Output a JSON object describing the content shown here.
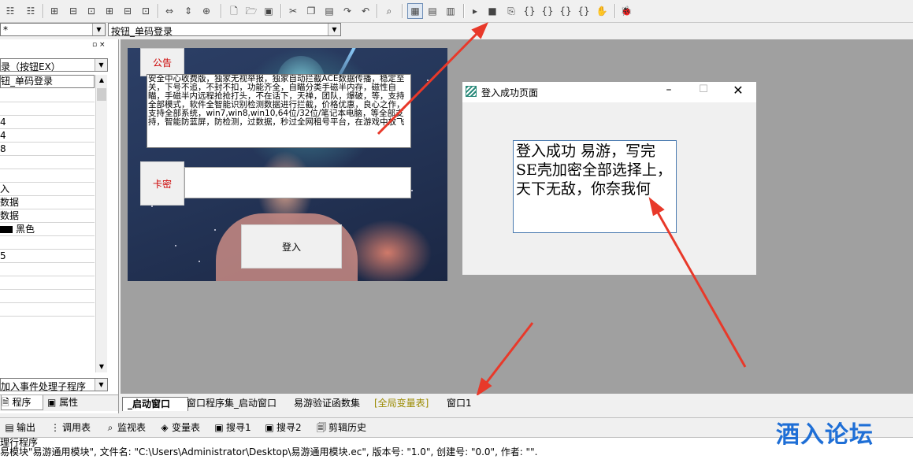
{
  "toolbar": {
    "icons": [
      "align-icon",
      "align-icon",
      "grid-icon",
      "grid-icon",
      "grid-icon",
      "grid-icon",
      "grid-icon",
      "resize-icon",
      "resize-icon",
      "resize-icon",
      "new-file-icon",
      "open-folder-icon",
      "save-icon",
      "cut-icon",
      "copy-icon",
      "paste-icon",
      "undo-icon",
      "redo-icon",
      "find-icon",
      "layout-icon",
      "layout-icon",
      "layout-icon",
      "run-icon",
      "stop-icon",
      "step-icon",
      "step-icon",
      "step-icon",
      "step-icon",
      "step-icon",
      "hand-icon",
      "debug-icon"
    ]
  },
  "combo_left": {
    "value": "*"
  },
  "combo_right": {
    "value": "按钮_单码登录"
  },
  "left_panel": {
    "title_combo": "录（按钮EX）",
    "name_row": "钮_单码登录",
    "rows": [
      "",
      "",
      "4",
      "4",
      "8",
      "",
      "",
      "入",
      "数据",
      "数据",
      "黑色",
      "",
      "5",
      "",
      "",
      "",
      ""
    ],
    "color_label": "黑色",
    "event_combo": "加入事件处理子程序",
    "tab_program": "程序",
    "tab_property": "属性"
  },
  "form1": {
    "notice_button": "公告",
    "notice_text": "安全中心收费版，独家无视举报，独家自动拦截ACE数据传播，稳定至关，下号不追，不封不扣，功能齐全，自瞄分类手磁半内存，磁性自瞄，手磁半内远程抢抢打头，不在话下，天禅，团队，爆破，等，支持全部模式，软件全智能识别检测数据进行拦截，价格优惠，良心之作，支持全部系统，win7,win8,win10,64位/32位/笔记本电脑，等全部支持，智能防蓝屏，防检测，过数据，秒过全网租号平台，在游戏中放飞",
    "card_label": "卡密",
    "login_button": "登入"
  },
  "win2": {
    "title": "登入成功页面",
    "message": "登入成功 易游，写完SE壳加密全部选择上，天下无敌，你奈我何"
  },
  "tabs": [
    "_启动窗口",
    "窗口程序集_启动窗口",
    "易游验证函数集",
    "[全局变量表]",
    "窗口1"
  ],
  "bottom_tabs": [
    "输出",
    "调用表",
    "监视表",
    "变量表",
    "搜寻1",
    "搜寻2",
    "剪辑历史"
  ],
  "output": {
    "line1": "理行程序",
    "line2": "易模块\"易游通用模块\", 文件名: \"C:\\Users\\Administrator\\Desktop\\易游通用模块.ec\", 版本号: \"1.0\", 创建号: \"0.0\", 作者: \"\"."
  },
  "watermark": "酒入论坛",
  "colors": {
    "arrow": "#e8392a",
    "watermark": "#1f6fd6",
    "tab_global": "#9a8a00",
    "label_red": "#cc0000"
  }
}
